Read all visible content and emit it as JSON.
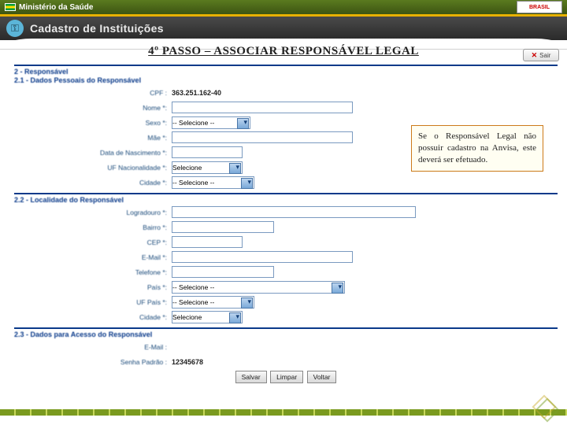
{
  "topbar": {
    "ministry": "Ministério da Saúde",
    "brasil": "BRASIL"
  },
  "header": {
    "title": "Cadastro de Instituições"
  },
  "step_title": "4º PASSO – ASSOCIAR RESPONSÁVEL LEGAL",
  "sair": {
    "label": "Sair",
    "x": "✕"
  },
  "callout": "Se o Responsável Legal não possuir cadastro na Anvisa, este deverá ser efetuado.",
  "section2": {
    "title": "2 - Responsável",
    "sub1": {
      "title": "2.1 - Dados Pessoais do Responsável",
      "cpf_label": "CPF :",
      "cpf_value": "363.251.162-40",
      "nome_label": "Nome *:",
      "sexo_label": "Sexo *:",
      "sexo_opt": "-- Selecione --",
      "mae_label": "Mãe *:",
      "nasc_label": "Data de Nascimento *:",
      "ufnac_label": "UF Nacionalidade *:",
      "ufnac_opt": "Selecione",
      "cidade_label": "Cidade *:",
      "cidade_opt": "-- Selecione --"
    },
    "sub2": {
      "title": "2.2 - Localidade do Responsável",
      "logradouro_label": "Logradouro *:",
      "bairro_label": "Bairro *:",
      "cep_label": "CEP *:",
      "email_label": "E-Mail *:",
      "telefone_label": "Telefone *:",
      "pais_label": "País *:",
      "pais_opt": "-- Selecione --",
      "ufpais_label": "UF País *:",
      "ufpais_opt": "-- Selecione --",
      "cidade_label": "Cidade *:",
      "cidade_opt": "Selecione"
    },
    "sub3": {
      "title": "2.3 - Dados para Acesso do Responsável",
      "email_label": "E-Mail :",
      "senha_label": "Senha Padrão :",
      "senha_value": "12345678"
    }
  },
  "buttons": {
    "salvar": "Salvar",
    "limpar": "Limpar",
    "voltar": "Voltar"
  }
}
